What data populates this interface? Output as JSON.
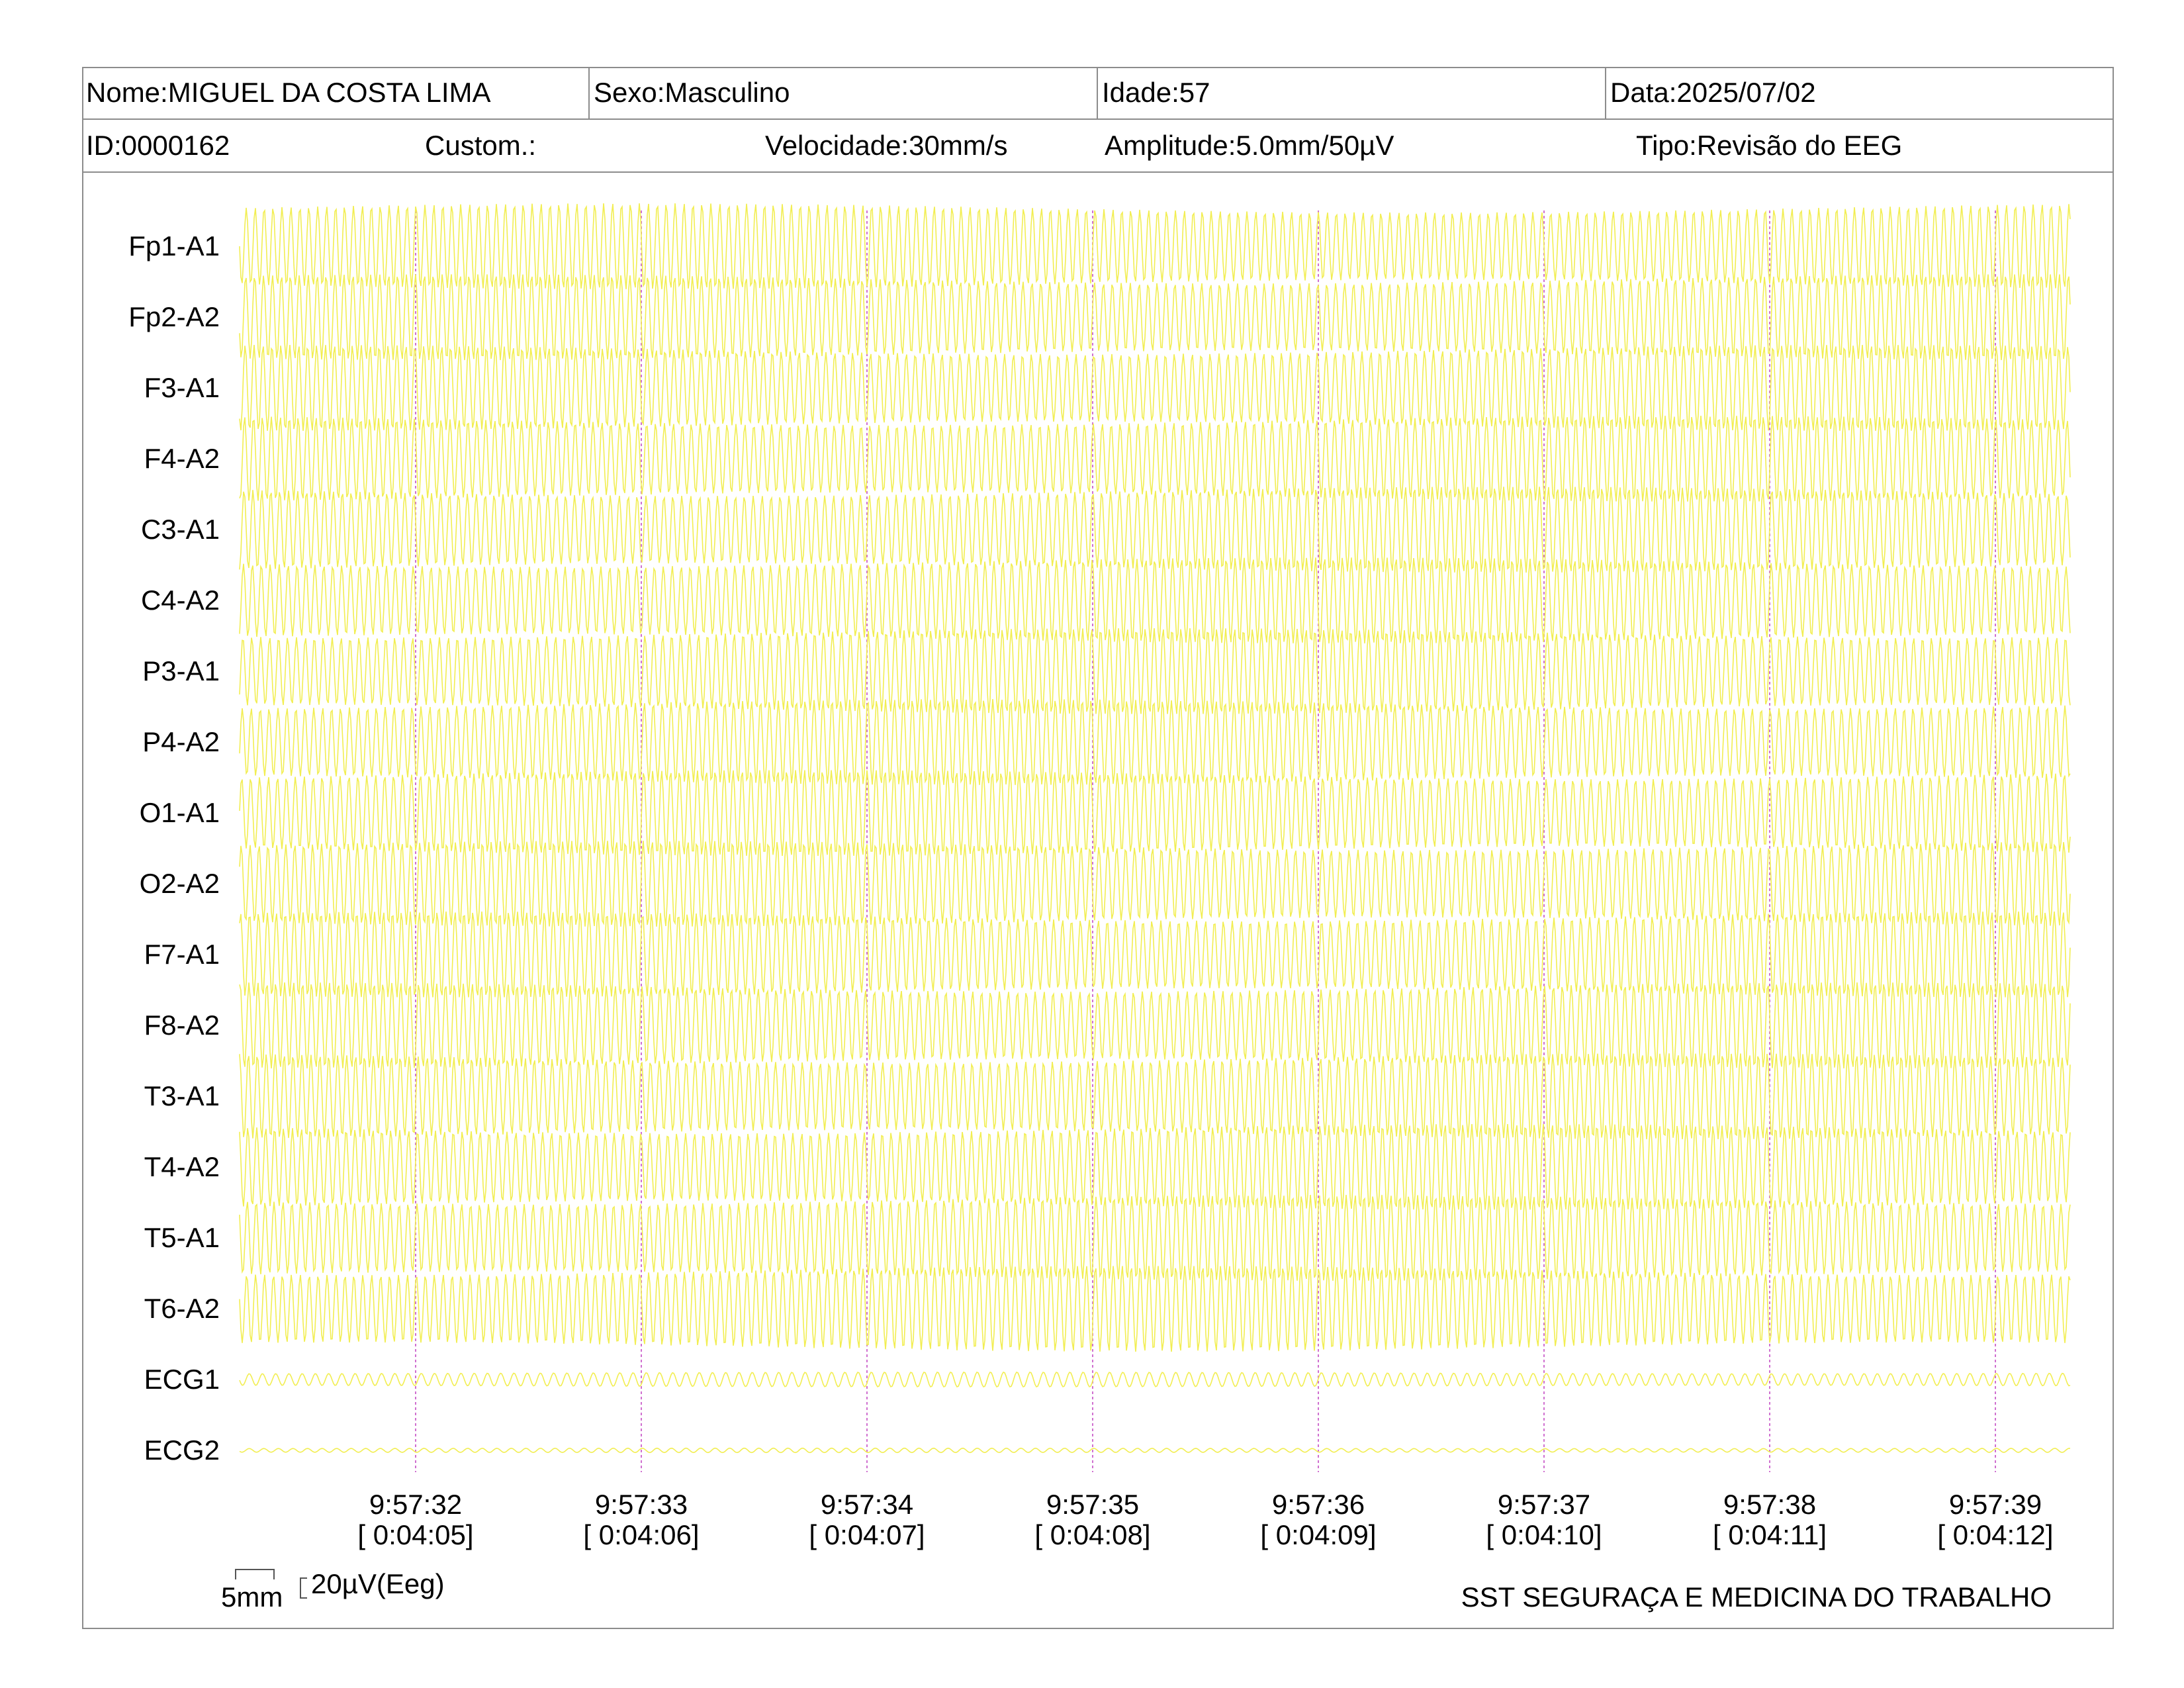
{
  "header": {
    "name": "Nome:MIGUEL DA COSTA LIMA",
    "sex": "Sexo:Masculino",
    "age": "Idade:57",
    "date": "Data:2025/07/02",
    "id": "ID:0000162",
    "custom": "Custom.:",
    "speed": "Velocidade:30mm/s",
    "amplitude": "Amplitude:5.0mm/50µV",
    "type": "Tipo:Revisão do EEG"
  },
  "channels": [
    "Fp1-A1",
    "Fp2-A2",
    "F3-A1",
    "F4-A2",
    "C3-A1",
    "C4-A2",
    "P3-A1",
    "P4-A2",
    "O1-A1",
    "O2-A2",
    "F7-A1",
    "F8-A2",
    "T3-A1",
    "T4-A2",
    "T5-A1",
    "T6-A2",
    "ECG1",
    "ECG2"
  ],
  "time_marks": [
    {
      "clock": "9:57:32",
      "elapsed": "[ 0:04:05]"
    },
    {
      "clock": "9:57:33",
      "elapsed": "[ 0:04:06]"
    },
    {
      "clock": "9:57:34",
      "elapsed": "[ 0:04:07]"
    },
    {
      "clock": "9:57:35",
      "elapsed": "[ 0:04:08]"
    },
    {
      "clock": "9:57:36",
      "elapsed": "[ 0:04:09]"
    },
    {
      "clock": "9:57:37",
      "elapsed": "[ 0:04:10]"
    },
    {
      "clock": "9:57:38",
      "elapsed": "[ 0:04:11]"
    },
    {
      "clock": "9:57:39",
      "elapsed": "[ 0:04:12]"
    }
  ],
  "scale": {
    "time_label": "5mm",
    "amp_label": "20µV(Eeg)"
  },
  "footer": "SST SEGURAÇA E MEDICINA DO TRABALHO",
  "colors": {
    "trace": "#f2ee52",
    "marker": "#d070d0",
    "border": "#8c8c8c"
  }
}
